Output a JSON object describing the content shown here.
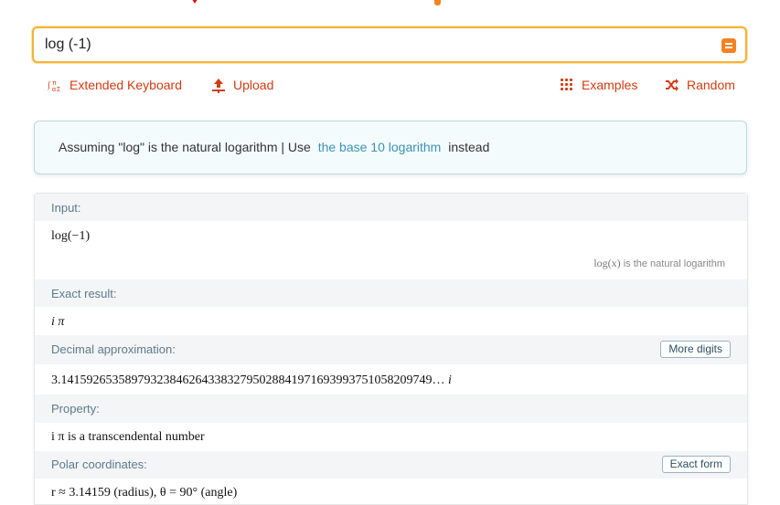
{
  "search": {
    "query": "log (-1)"
  },
  "toolbar": {
    "keyboard_label": "Extended Keyboard",
    "upload_label": "Upload",
    "examples_label": "Examples",
    "random_label": "Random"
  },
  "assumption": {
    "prefix": "Assuming \"log\" is the natural logarithm | Use",
    "link": "the base 10 logarithm",
    "suffix": "instead"
  },
  "pods": {
    "input": {
      "title": "Input:",
      "value": "log(−1)",
      "note_math": "log(x)",
      "note_text": " is the natural logarithm"
    },
    "exact": {
      "title": "Exact result:",
      "value": "i π"
    },
    "decimal": {
      "title": "Decimal approximation:",
      "button": "More digits",
      "value": "3.1415926535897932384626433832795028841971693993751058209749…",
      "unit": "i"
    },
    "property": {
      "title": "Property:",
      "value": "i π is a transcendental number"
    },
    "polar": {
      "title": "Polar coordinates:",
      "button": "Exact form",
      "value": "r ≈ 3.14159 (radius),  θ = 90° (angle)"
    }
  },
  "colors": {
    "accent_orange": "#f58220",
    "toolbar_red": "#d33c12",
    "link_blue": "#3c93b7",
    "pod_title": "#5e7b8b"
  }
}
